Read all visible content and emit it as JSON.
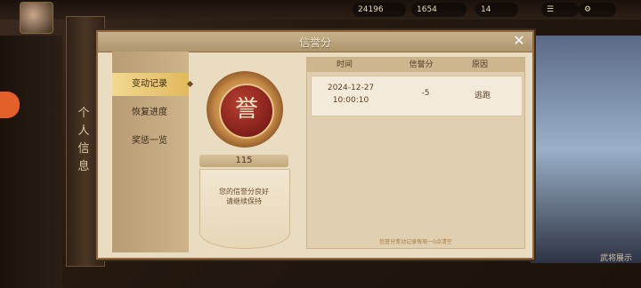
{
  "top_resources": [
    "24196",
    "1654",
    "14"
  ],
  "side_panel": {
    "title": "个人信息"
  },
  "bottom_right_text": "武将展示",
  "dialog": {
    "title": "信誉分",
    "close_icon": "close-icon",
    "tabs": [
      {
        "label": "变动记录",
        "active": true
      },
      {
        "label": "恢复进度",
        "active": false
      },
      {
        "label": "奖惩一览",
        "active": false
      }
    ],
    "medal_char": "誉",
    "score": "115",
    "note_line1": "您的信誉分良好",
    "note_line2": "请继续保持",
    "help_label": "?",
    "table": {
      "headers": [
        "时间",
        "信誉分",
        "原因"
      ],
      "rows": [
        {
          "date": "2024-12-27",
          "time": "10:00:10",
          "delta": "-5",
          "reason": "逃跑"
        }
      ],
      "footer": "信誉分变动记录每周一0点清空"
    }
  },
  "colors": {
    "accent_gold": "#e1b95d",
    "medal_red": "#7c1c17",
    "text_brown": "#5a3f26"
  }
}
